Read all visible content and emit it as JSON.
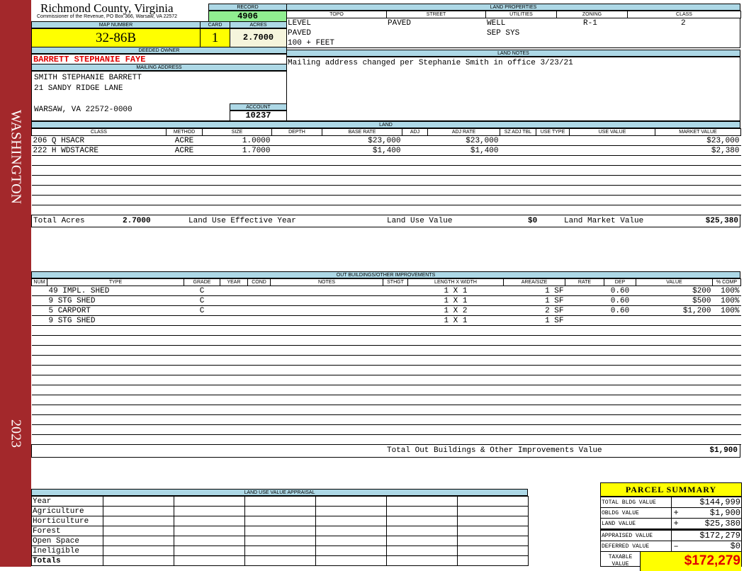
{
  "sidebar": {
    "district": "WASHINGTON",
    "year": "2023"
  },
  "header": {
    "county": "Richmond County, Virginia",
    "subtitle": "Commissioner of the Revenue, PO Box 366, Warsaw, VA 22572"
  },
  "record": {
    "label": "RECORD",
    "value": "4906"
  },
  "map": {
    "label": "MAP NUMBER",
    "value": "32-86B"
  },
  "card": {
    "label": "CARD",
    "value": "1"
  },
  "acres": {
    "label": "ACRES",
    "value": "2.7000"
  },
  "owner": {
    "label": "DEEDED OWNER",
    "value": "BARRETT STEPHANIE FAYE"
  },
  "mailing": {
    "label": "MAILING ADDRESS",
    "line1": "SMITH STEPHANIE BARRETT",
    "line2": "21 SANDY RIDGE LANE",
    "line3": "WARSAW, VA 22572-0000"
  },
  "account": {
    "label": "ACCOUNT",
    "value": "10237"
  },
  "land_properties": {
    "label": "LAND PROPERTIES",
    "columns": [
      "TOPO",
      "STREET",
      "UTILITIES",
      "ZONING",
      "CLASS"
    ],
    "topo": [
      "LEVEL",
      "PAVED",
      "100 + FEET"
    ],
    "street": [
      "PAVED"
    ],
    "utilities": [
      "WELL",
      "SEP SYS"
    ],
    "zoning": "R-1",
    "class": "2"
  },
  "land_notes": {
    "label": "LAND NOTES",
    "text": "Mailing address changed per Stephanie Smith in office 3/23/21"
  },
  "land": {
    "label": "LAND",
    "columns": [
      "CLASS",
      "METHOD",
      "SIZE",
      "DEPTH",
      "BASE RATE",
      "ADJ",
      "ADJ RATE",
      "SZ ADJ TBL",
      "USE TYPE",
      "USE VALUE",
      "MARKET VALUE"
    ],
    "rows": [
      [
        "206 Q HSACR",
        "ACRE",
        "1.0000",
        "",
        "$23,000",
        "",
        "$23,000",
        "",
        "",
        "",
        "$23,000"
      ],
      [
        "222 H WDSTACRE",
        "ACRE",
        "1.7000",
        "",
        "$1,400",
        "",
        "$1,400",
        "",
        "",
        "",
        "$2,380"
      ]
    ],
    "total_acres_label": "Total Acres",
    "total_acres": "2.7000",
    "effective_year_label": "Land Use Effective Year",
    "effective_year": "",
    "use_value_label": "Land Use Value",
    "use_value": "$0",
    "market_value_label": "Land Market Value",
    "market_value": "$25,380"
  },
  "outbuildings": {
    "label": "OUT BUILDINGS/OTHER IMPROVEMENTS",
    "columns": [
      "NUM",
      "TYPE",
      "GRADE",
      "YEAR",
      "COND",
      "NOTES",
      "STHGT",
      "LENGTH X WIDTH",
      "AREA/SIZE",
      "RATE",
      "DEP",
      "VALUE",
      "% COMP"
    ],
    "rows": [
      [
        "",
        "49  IMPL. SHED",
        "C",
        "",
        "",
        "",
        "",
        "1 X 1",
        "1 SF",
        "",
        "0.60",
        "$200",
        "100%"
      ],
      [
        "",
        "9  STG SHED",
        "C",
        "",
        "",
        "",
        "",
        "1 X 1",
        "1 SF",
        "",
        "0.60",
        "$500",
        "100%"
      ],
      [
        "",
        "5  CARPORT",
        "C",
        "",
        "",
        "",
        "",
        "1 X 2",
        "2 SF",
        "",
        "0.60",
        "$1,200",
        "100%"
      ],
      [
        "",
        "9  STG SHED",
        "",
        "",
        "",
        "",
        "",
        "1 X 1",
        "1 SF",
        "",
        "",
        "",
        ""
      ]
    ],
    "total_label": "Total Out Buildings & Other Improvements Value",
    "total": "$1,900"
  },
  "land_use_appraisal": {
    "label": "LAND USE VALUE APPRAISAL",
    "rows": [
      "Year",
      "Agriculture",
      "Horticulture",
      "Forest",
      "Open Space",
      "Ineligible",
      "Totals"
    ]
  },
  "parcel_summary": {
    "title": "PARCEL SUMMARY",
    "rows": [
      {
        "label": "TOTAL BLDG VALUE",
        "sign": "",
        "value": "$144,999"
      },
      {
        "label": "OBLDG VALUE",
        "sign": "+",
        "value": "$1,900"
      },
      {
        "label": "LAND VALUE",
        "sign": "+",
        "value": "$25,380"
      },
      {
        "label": "APPRAISED VALUE",
        "sign": "",
        "value": "$172,279"
      },
      {
        "label": "DEFERRED VALUE",
        "sign": "–",
        "value": "$0"
      }
    ],
    "taxable_label": "TAXABLE VALUE",
    "taxable_value": "$172,279"
  },
  "colors": {
    "sidebar": "#a3282b",
    "header": "#add8e6",
    "highlight": "#ffff00",
    "record": "#90ee90",
    "owner": "#e00000"
  }
}
